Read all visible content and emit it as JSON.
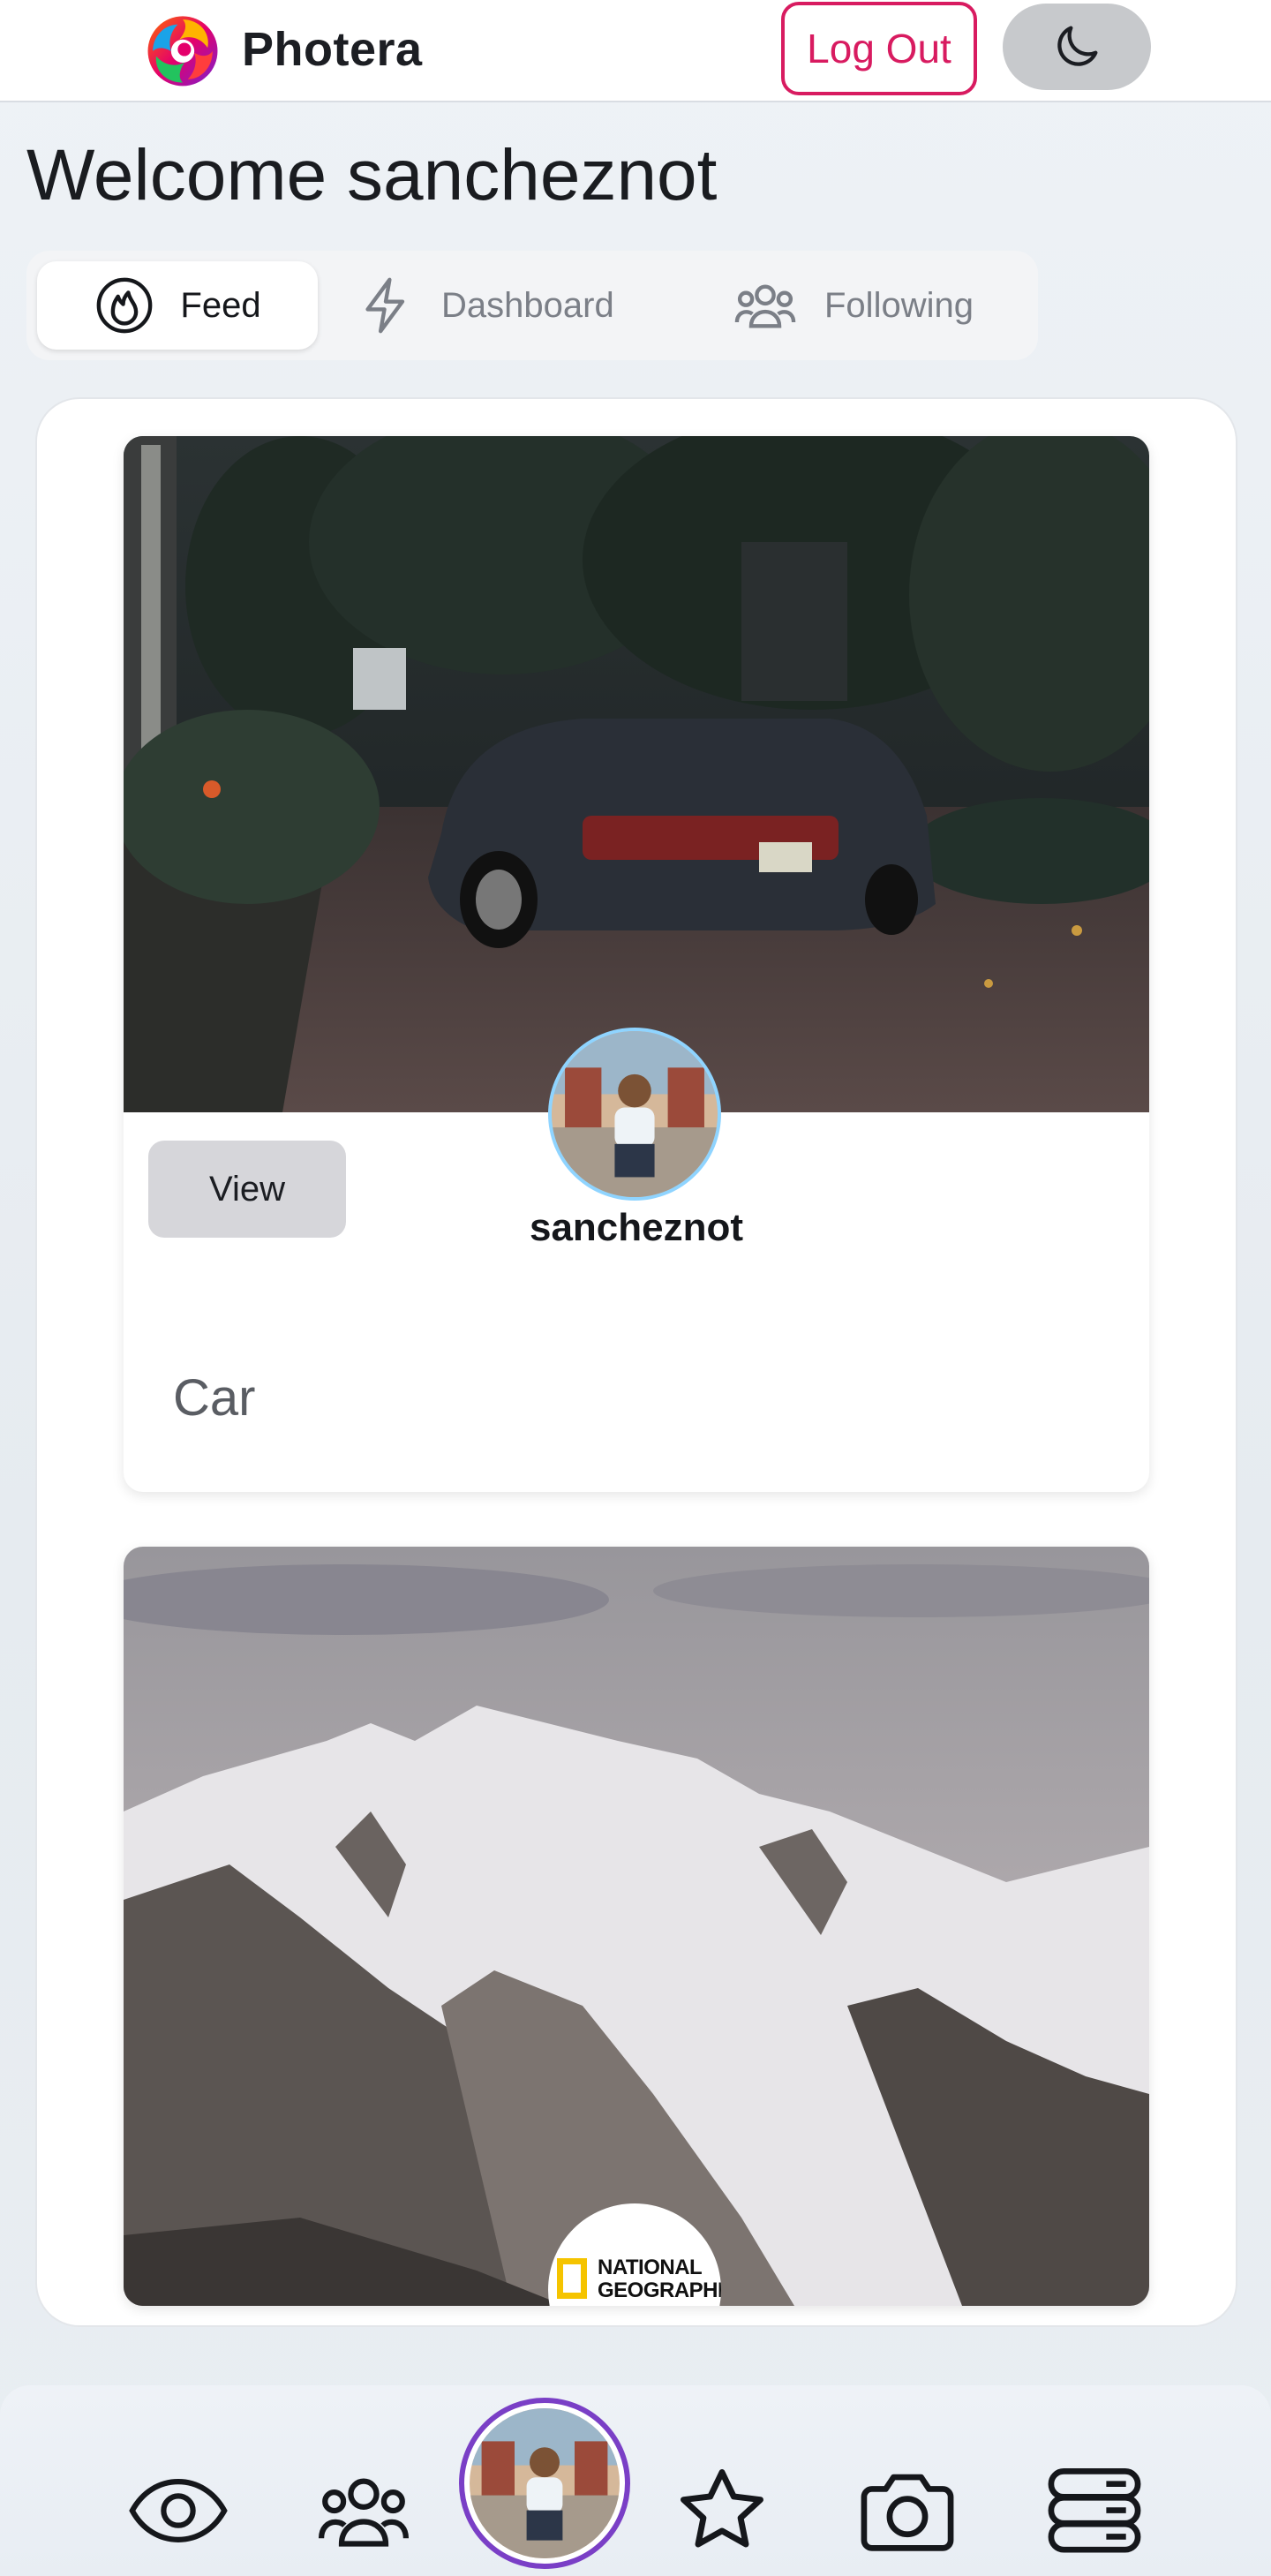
{
  "app": {
    "name": "Photera"
  },
  "header": {
    "logout_label": "Log Out",
    "theme_icon": "moon-icon"
  },
  "welcome": {
    "text": "Welcome sancheznot"
  },
  "tabs": [
    {
      "label": "Feed",
      "icon": "flame-icon",
      "active": true
    },
    {
      "label": "Dashboard",
      "icon": "lightning-icon",
      "active": false
    },
    {
      "label": "Following",
      "icon": "users-icon",
      "active": false
    }
  ],
  "posts": [
    {
      "view_label": "View",
      "username": "sancheznot",
      "caption": "Car"
    },
    {
      "badge_text_1": "NATIONAL",
      "badge_text_2": "GEOGRAPHIC"
    }
  ],
  "bottom_nav": {
    "items": [
      "eye-icon",
      "users-icon",
      "profile-avatar",
      "star-icon",
      "camera-icon",
      "server-icon"
    ]
  },
  "colors": {
    "accent": "#d81b60",
    "profile_ring": "#7a3fc6",
    "avatar_ring": "#8fd4ff"
  }
}
